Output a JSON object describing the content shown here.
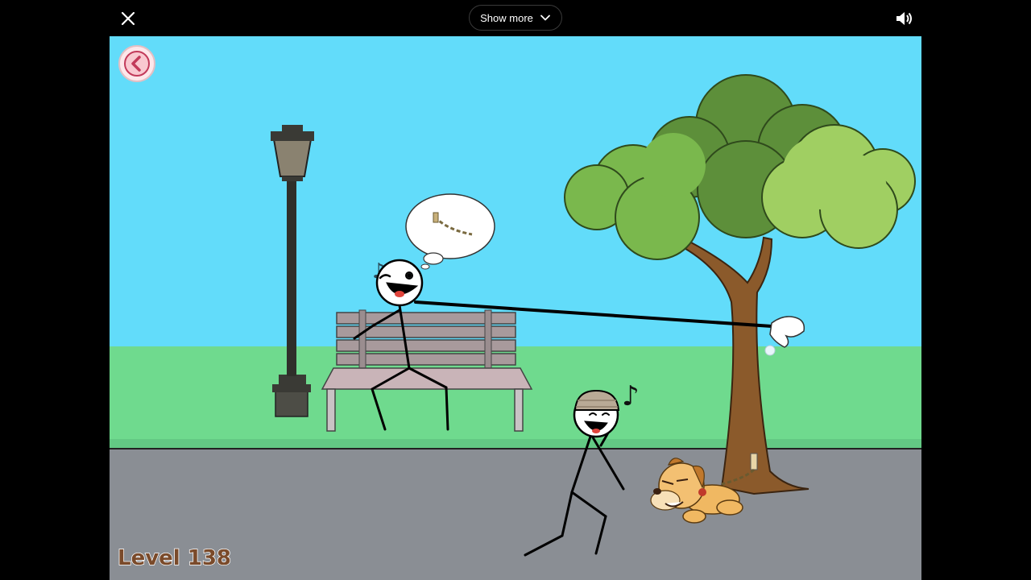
{
  "topbar": {
    "close_icon": "close-icon",
    "show_more_label": "Show more",
    "chevron_icon": "chevron-down-icon",
    "volume_icon": "volume-icon"
  },
  "game": {
    "back_icon": "back-arrow-icon",
    "level_text": "Level 138",
    "colors": {
      "sky": "#62dcfa",
      "grass": "#6fda8e",
      "road": "#8a8e94",
      "tree_trunk": "#8b5a2b",
      "leaves_dark": "#5d8f3a",
      "leaves_mid": "#7ab84d",
      "leaves_light": "#a0cf62",
      "bench": "#a89a9c",
      "lamp": "#3a3a35"
    }
  }
}
